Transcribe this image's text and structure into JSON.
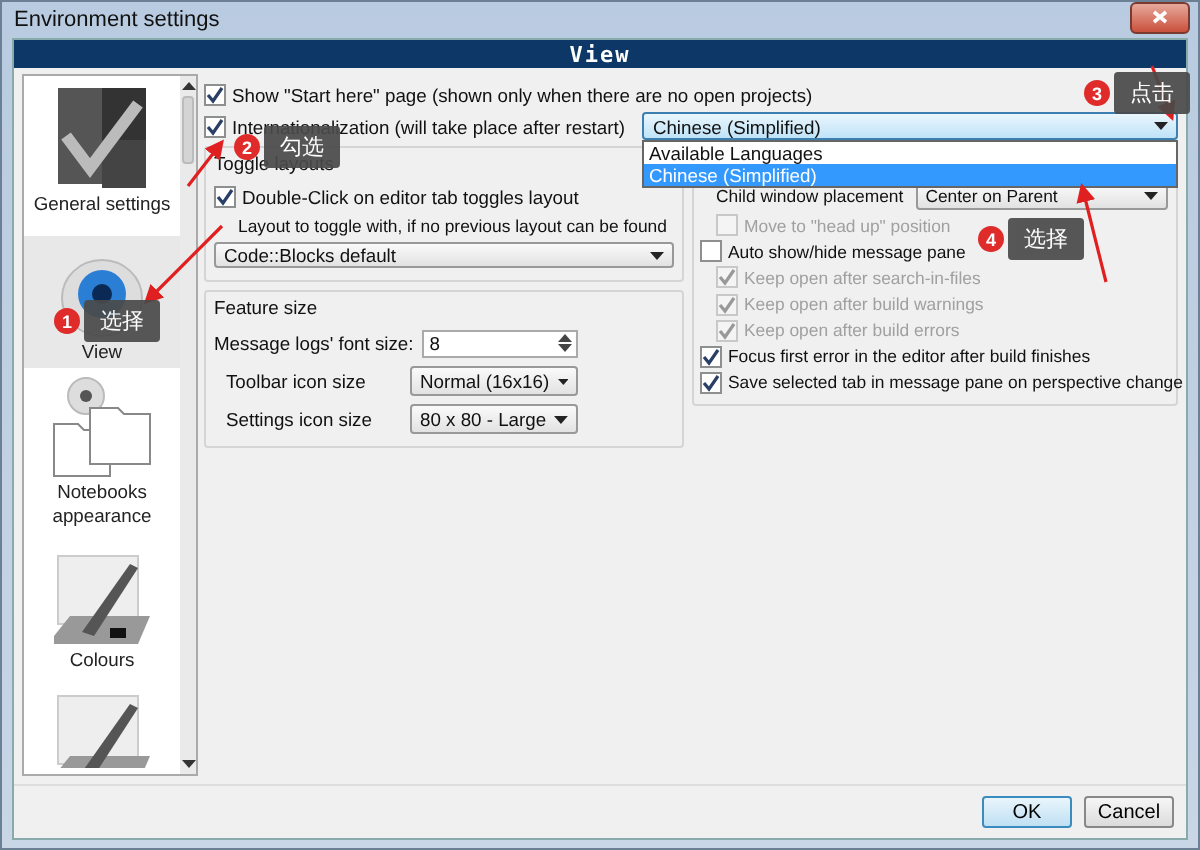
{
  "window": {
    "title": "Environment settings"
  },
  "header": {
    "title": "View"
  },
  "sidebar": {
    "items": [
      {
        "label": "General settings",
        "selected": false
      },
      {
        "label": "View",
        "selected": true
      },
      {
        "label": "Notebooks appearance",
        "selected": false
      },
      {
        "label": "Colours",
        "selected": false
      },
      {
        "selected": false
      }
    ]
  },
  "options": [
    {
      "label": "Show \"Start here\" page (shown only when there are no open projects)",
      "checked": true
    },
    {
      "label": "Internationalization (will take place after restart)",
      "checked": true
    }
  ],
  "language": {
    "value": "Chinese (Simplified)",
    "expanded": true,
    "options": [
      {
        "label": "Available Languages",
        "selected": false
      },
      {
        "label": "Chinese (Simplified)",
        "selected": true
      }
    ]
  },
  "toggle_layouts": {
    "title": "Toggle layouts",
    "double_click": {
      "label": "Double-Click on editor tab toggles layout",
      "checked": true
    },
    "layout_label": "Layout to toggle with, if no previous layout can be found",
    "layout_value": "Code::Blocks default"
  },
  "feature_size": {
    "title": "Feature size",
    "rows": [
      {
        "kind": "spin",
        "label": "Message logs' font size:",
        "value": "8"
      },
      {
        "kind": "combo",
        "label": "Toolbar icon size",
        "value": "Normal (16x16)"
      },
      {
        "kind": "combo",
        "label": "Settings icon size",
        "value": "80 x 80 - Large"
      }
    ]
  },
  "panes": {
    "rows": [
      {
        "kind": "combo",
        "label": "Child window placement",
        "value": "Center on Parent",
        "children": [
          {
            "kind": "checkbox",
            "label": "Move to \"head up\" position",
            "checked": false,
            "disabled": true
          }
        ]
      },
      {
        "kind": "checkbox",
        "label": "Auto show/hide message pane",
        "checked": false,
        "disabled": false,
        "children": [
          {
            "kind": "checkbox",
            "label": "Keep open after search-in-files",
            "checked": true,
            "disabled": true
          },
          {
            "kind": "checkbox",
            "label": "Keep open after build warnings",
            "checked": true,
            "disabled": true
          },
          {
            "kind": "checkbox",
            "label": "Keep open after build errors",
            "checked": true,
            "disabled": true
          }
        ]
      },
      {
        "kind": "checkbox",
        "label": "Focus first error in the editor after build finishes",
        "checked": true,
        "disabled": false
      },
      {
        "kind": "checkbox",
        "label": "Save selected tab in message pane on perspective change",
        "checked": true,
        "disabled": false
      }
    ]
  },
  "buttons": [
    {
      "label": "OK",
      "default": true
    },
    {
      "label": "Cancel",
      "default": false
    }
  ],
  "annotations": [
    {
      "number": "1",
      "text": "选择"
    },
    {
      "number": "2",
      "text": "勾选"
    },
    {
      "number": "3",
      "text": "点击"
    },
    {
      "number": "4",
      "text": "选择"
    }
  ]
}
